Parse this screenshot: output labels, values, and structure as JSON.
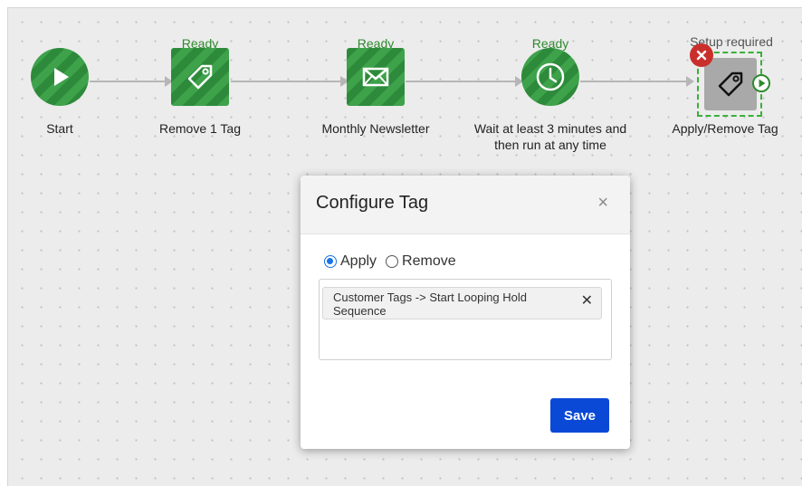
{
  "workflow": {
    "nodes": [
      {
        "label": "Start",
        "status": "",
        "icon": "play-icon"
      },
      {
        "label": "Remove 1 Tag",
        "status": "Ready",
        "icon": "tag-icon"
      },
      {
        "label": "Monthly Newsletter",
        "status": "Ready",
        "icon": "envelope-icon"
      },
      {
        "label": "Wait at least 3 minutes and then run at any time",
        "status": "Ready",
        "icon": "clock-icon"
      },
      {
        "label": "Apply/Remove Tag",
        "status": "Setup required",
        "icon": "tag-icon"
      }
    ],
    "colors": {
      "ready_green": "#2f8a2f",
      "node_green": "#2d8a3a",
      "setup_gray": "#a9a9a9",
      "delete_red": "#c9302c"
    }
  },
  "modal": {
    "title": "Configure Tag",
    "close_glyph": "×",
    "options": [
      {
        "label": "Apply",
        "selected": true
      },
      {
        "label": "Remove",
        "selected": false
      }
    ],
    "tags": [
      {
        "label": "Customer Tags -> Start Looping Hold Sequence",
        "remove_glyph": "✕"
      }
    ],
    "save_label": "Save",
    "save_color": "#0a49d6"
  }
}
